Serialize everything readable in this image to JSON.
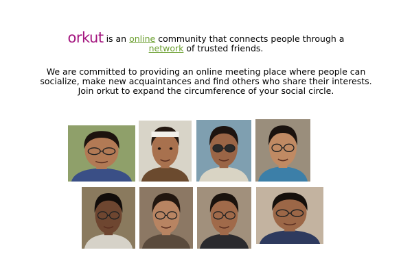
{
  "logo": "orkut",
  "intro": {
    "part1": "is an",
    "online_link": "online",
    "part2": "community that connects people through a",
    "network_link": "network",
    "part3": "of trusted friends."
  },
  "mission": "We are committed to providing an online meeting place where people can socialize, make new acquaintances and find others who share their interests. Join orkut to expand the circumference of your social circle.",
  "photos": [
    {
      "bg": "#8fa06a",
      "skin": "#b27a55",
      "hair": "#1c130e",
      "shirt": "#3a4f86",
      "glasses": true
    },
    {
      "bg": "#d8d4c8",
      "skin": "#a8714e",
      "hair": "#241811",
      "shirt": "#6b4a2e",
      "glasses": false,
      "headband": true
    },
    {
      "bg": "#7f9fb0",
      "skin": "#9a6546",
      "hair": "#1d1410",
      "shirt": "#d9d4c4",
      "glasses": true,
      "sunglasses": true
    },
    {
      "bg": "#9a8e7c",
      "skin": "#c08a63",
      "hair": "#1a120e",
      "shirt": "#3c7fa8",
      "glasses": true
    },
    {
      "bg": "#8a7a5e",
      "skin": "#6e4630",
      "hair": "#120d0a",
      "shirt": "#d6d2c8",
      "glasses": true
    },
    {
      "bg": "#8c7864",
      "skin": "#b88462",
      "hair": "#22160f",
      "shirt": "#5a4a3c",
      "glasses": true
    },
    {
      "bg": "#a1907c",
      "skin": "#a06a4a",
      "hair": "#1a120d",
      "shirt": "#2a2a2e",
      "glasses": true
    },
    {
      "bg": "#c3b3a0",
      "skin": "#9c6747",
      "hair": "#150f0b",
      "shirt": "#2e3a5e",
      "glasses": true
    }
  ]
}
